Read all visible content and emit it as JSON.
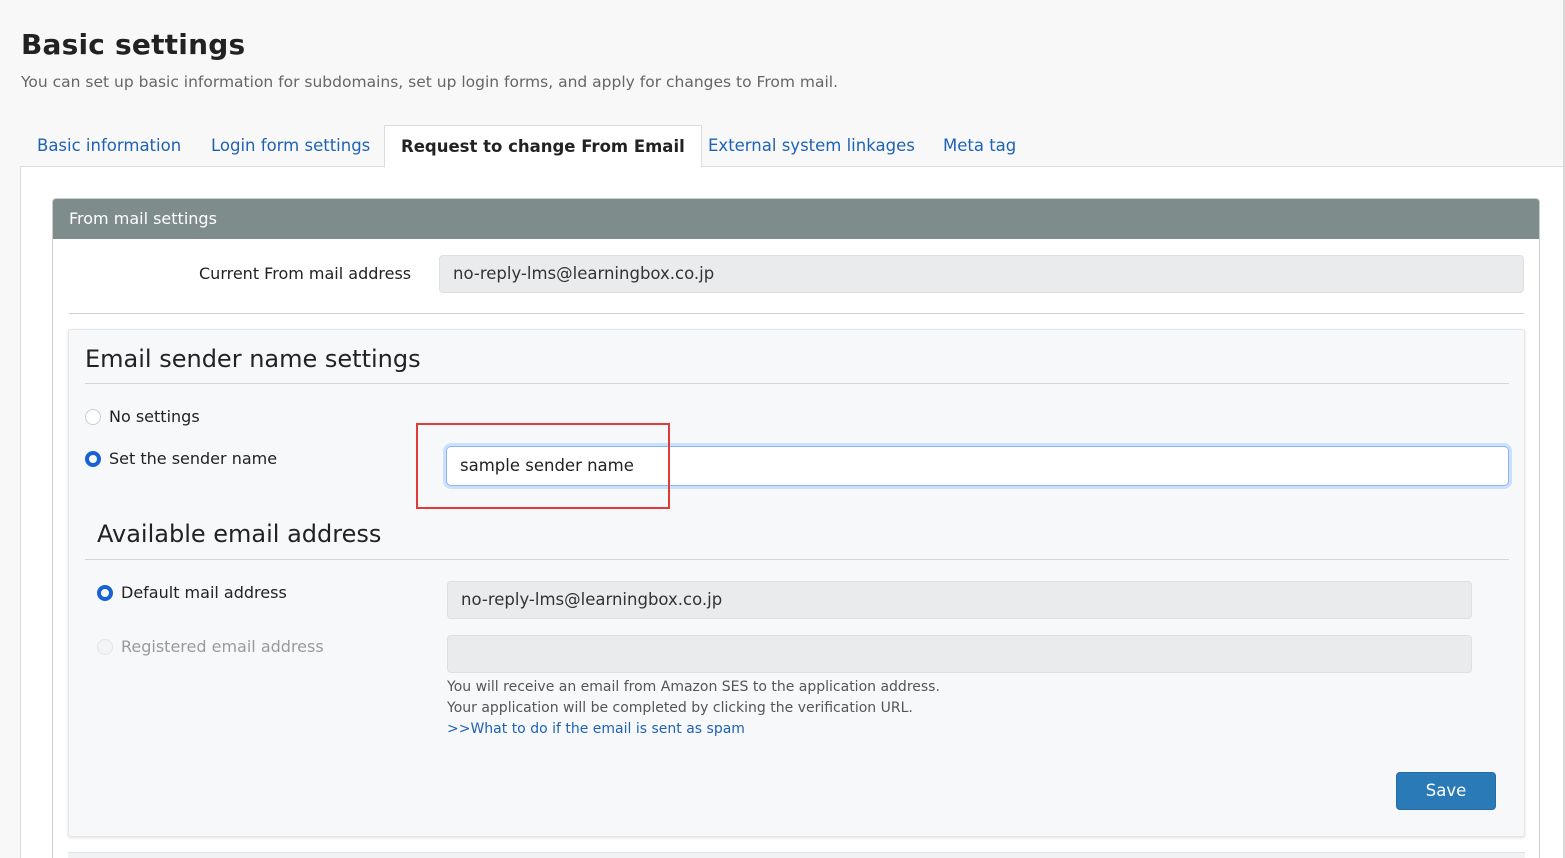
{
  "page": {
    "title": "Basic settings",
    "description": "You can set up basic information for subdomains, set up login forms, and apply for changes to From mail."
  },
  "tabs": [
    {
      "label": "Basic information",
      "active": false
    },
    {
      "label": "Login form settings",
      "active": false
    },
    {
      "label": "Request to change From Email",
      "active": true
    },
    {
      "label": "External system linkages",
      "active": false
    },
    {
      "label": "Meta tag",
      "active": false
    }
  ],
  "from_mail": {
    "panel_title": "From mail settings",
    "current_label": "Current From mail address",
    "current_value": "no-reply-lms@learningbox.co.jp"
  },
  "sender_name": {
    "title": "Email sender name settings",
    "options": [
      {
        "label": "No settings",
        "checked": false
      },
      {
        "label": "Set the sender name",
        "checked": true
      }
    ],
    "input_value": "sample sender name"
  },
  "available_address": {
    "title": "Available email address",
    "options": [
      {
        "label": "Default mail address",
        "checked": true,
        "disabled": false,
        "value": "no-reply-lms@learningbox.co.jp"
      },
      {
        "label": "Registered email address",
        "checked": false,
        "disabled": true,
        "value": ""
      }
    ],
    "help_line1": "You will receive an email from Amazon SES to the application address.",
    "help_line2": "Your application will be completed by clicking the verification URL.",
    "help_link": ">>What to do if the email is sent as spam"
  },
  "actions": {
    "save_label": "Save"
  },
  "colors": {
    "link": "#1f62b5",
    "panel_header": "#7f8c8c",
    "primary_button": "#2a7ab8",
    "radio_checked": "#1763d6",
    "highlight": "#e03a3a"
  }
}
